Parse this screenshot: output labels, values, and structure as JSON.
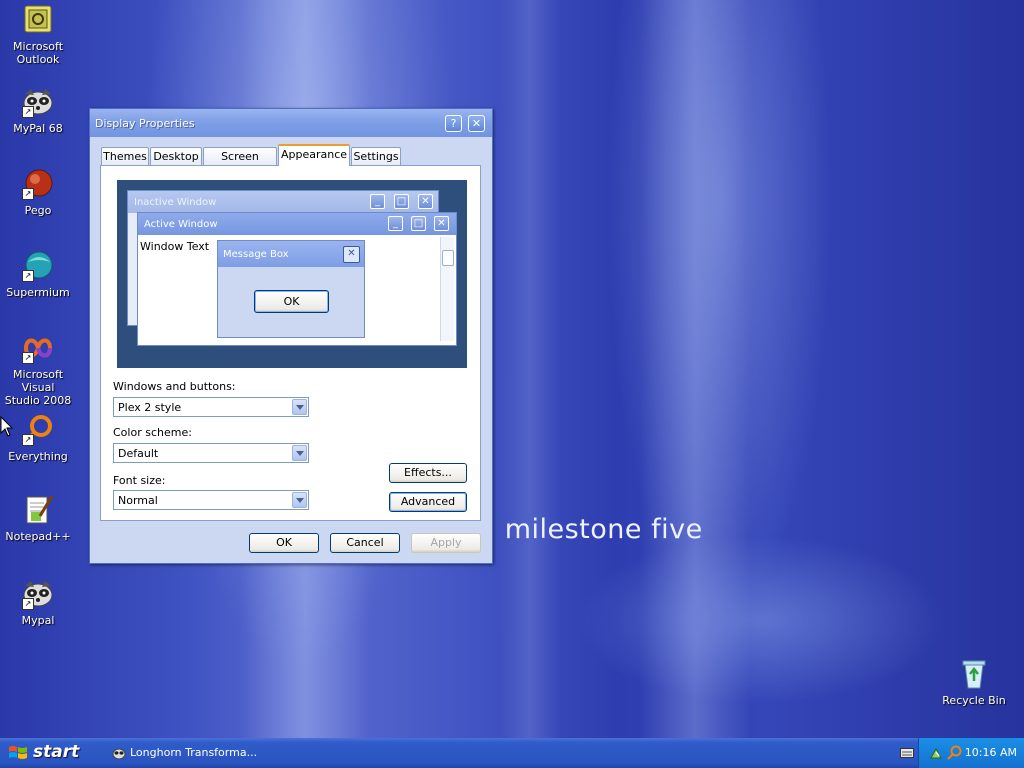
{
  "desktop": {
    "icons": [
      {
        "label": "Microsoft\nOutlook",
        "icon": "outlook-icon"
      },
      {
        "label": "MyPal 68",
        "icon": "raccoon-icon"
      },
      {
        "label": "Pego",
        "icon": "pego-icon"
      },
      {
        "label": "Supermium",
        "icon": "supermium-icon"
      },
      {
        "label": "Microsoft Visual\nStudio 2008",
        "icon": "visual-studio-icon"
      },
      {
        "label": "Everything",
        "icon": "everything-icon"
      },
      {
        "label": "Notepad++",
        "icon": "notepadpp-icon"
      },
      {
        "label": "Mypal",
        "icon": "raccoon-icon"
      },
      {
        "label": "Recycle Bin",
        "icon": "recycle-bin-icon"
      }
    ],
    "wallpaper_text": "n milestone five"
  },
  "dialog": {
    "title": "Display Properties",
    "help_btn": "?",
    "close_btn": "✕",
    "tabs": [
      "Themes",
      "Desktop",
      "Screen Saver",
      "Appearance",
      "Settings"
    ],
    "active_tab": "Appearance",
    "preview": {
      "inactive_window": "Inactive Window",
      "active_window": "Active Window",
      "window_text": "Window Text",
      "message_box": "Message Box",
      "ok": "OK"
    },
    "windows_buttons_label": "Windows and buttons:",
    "windows_buttons_value": "Plex 2 style",
    "color_scheme_label": "Color scheme:",
    "color_scheme_value": "Default",
    "font_size_label": "Font size:",
    "font_size_value": "Normal",
    "effects_btn": "Effects...",
    "advanced_btn": "Advanced",
    "ok_btn": "OK",
    "cancel_btn": "Cancel",
    "apply_btn": "Apply"
  },
  "taskbar": {
    "start": "start",
    "task": "Longhorn Transforma...",
    "clock": "10:16 AM"
  },
  "colors": {
    "taskbar": "#2a54c0",
    "tray": "#1470cf",
    "dialog_title": "#7d9ee6",
    "preview_bg": "#2e4f7c"
  }
}
